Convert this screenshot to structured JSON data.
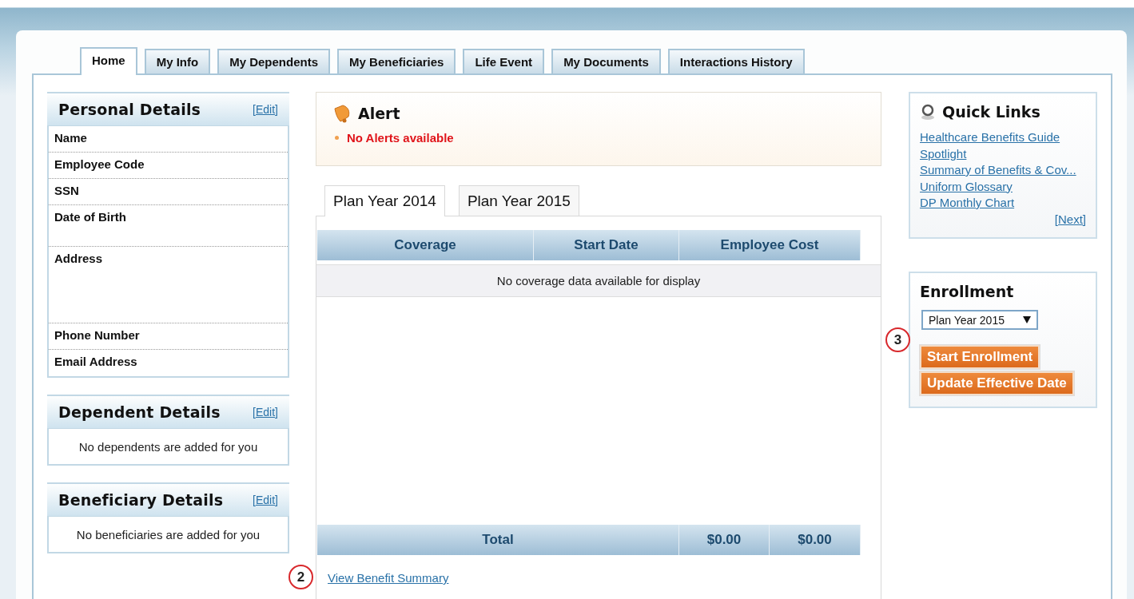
{
  "tabs": [
    {
      "label": "Home",
      "selected": true
    },
    {
      "label": "My Info",
      "selected": false
    },
    {
      "label": "My Dependents",
      "selected": false
    },
    {
      "label": "My Beneficiaries",
      "selected": false
    },
    {
      "label": "Life Event",
      "selected": false
    },
    {
      "label": "My Documents",
      "selected": false
    },
    {
      "label": "Interactions History",
      "selected": false
    }
  ],
  "personal_details": {
    "title": "Personal Details",
    "edit_link": "[Edit]",
    "fields": [
      {
        "label": "Name",
        "kind": "short"
      },
      {
        "label": "Employee Code",
        "kind": "short"
      },
      {
        "label": "SSN",
        "kind": "short"
      },
      {
        "label": "Date of Birth",
        "kind": "tall"
      },
      {
        "label": "Address",
        "kind": "address"
      },
      {
        "label": "Phone Number",
        "kind": "short"
      },
      {
        "label": "Email Address",
        "kind": "short"
      }
    ]
  },
  "dependent_details": {
    "title": "Dependent Details",
    "edit_link": "[Edit]",
    "message": "No dependents are added for you"
  },
  "beneficiary_details": {
    "title": "Beneficiary Details",
    "edit_link": "[Edit]",
    "message": "No beneficiaries are added for you"
  },
  "alert": {
    "title": "Alert",
    "items": [
      "No Alerts available"
    ]
  },
  "plan_tabs": [
    {
      "label": "Plan Year 2014",
      "selected": true
    },
    {
      "label": "Plan Year 2015",
      "selected": false
    }
  ],
  "coverage_table": {
    "columns": [
      "Coverage",
      "Start Date",
      "Employee Cost"
    ],
    "empty_message": "No coverage data available for display",
    "total_row": [
      "Total",
      "$0.00",
      "$0.00"
    ]
  },
  "benefit_summary_link": {
    "label": "View Benefit Summary",
    "callout": "2"
  },
  "quick_links": {
    "title": "Quick Links",
    "links": [
      "Healthcare Benefits Guide",
      "Spotlight",
      "Summary of Benefits & Cov...",
      "Uniform Glossary",
      "DP Monthly Chart"
    ],
    "next_link": "[Next]"
  },
  "enrollment": {
    "title": "Enrollment",
    "plan_select": "Plan Year 2015",
    "buttons": [
      "Start Enrollment",
      "Update Effective Date"
    ],
    "callout": "3"
  }
}
